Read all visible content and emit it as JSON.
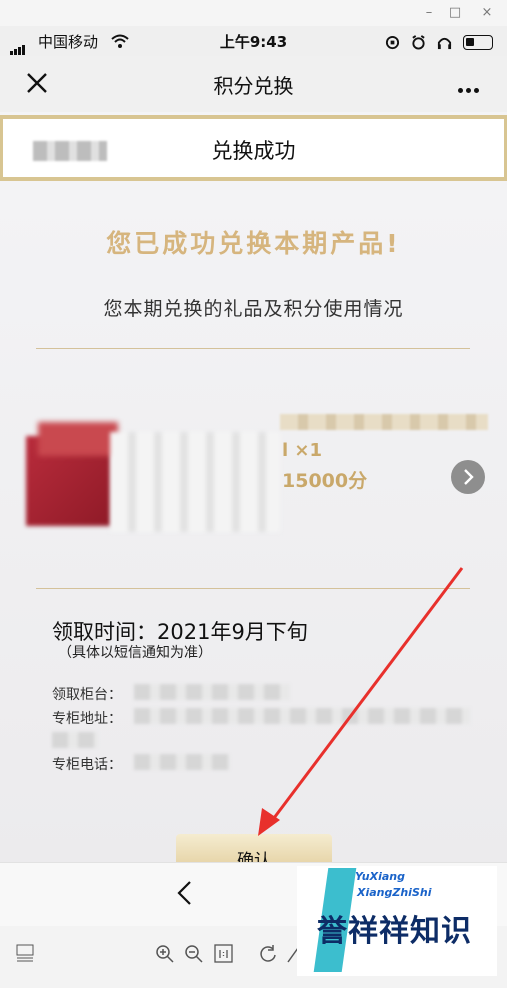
{
  "window": {
    "min": "–",
    "max": "□",
    "close": "×"
  },
  "status_bar": {
    "carrier": "中国移动",
    "time": "上午9:43"
  },
  "navbar": {
    "title": "积分兑换",
    "close_icon": "close-icon",
    "more_icon": "more-icon"
  },
  "success": {
    "header_title": "兑换成功",
    "headline": "您已成功兑换本期产品!",
    "subline": "您本期兑换的礼品及积分使用情况"
  },
  "product": {
    "quantity": "l ×1",
    "points": "15000分"
  },
  "pickup": {
    "time": "领取时间：2021年9月下旬",
    "note": "（具体以短信通知为准）",
    "counter_label": "领取柜台：",
    "address_label": "专柜地址：",
    "phone_label": "专柜电话："
  },
  "confirm_label": "确认",
  "watermark": {
    "en1": "YuXiang",
    "en2": "XiangZhiShi",
    "cn": "誉祥祥知识"
  },
  "colors": {
    "gold": "#d6b57e",
    "arrow": "#e8302c"
  }
}
